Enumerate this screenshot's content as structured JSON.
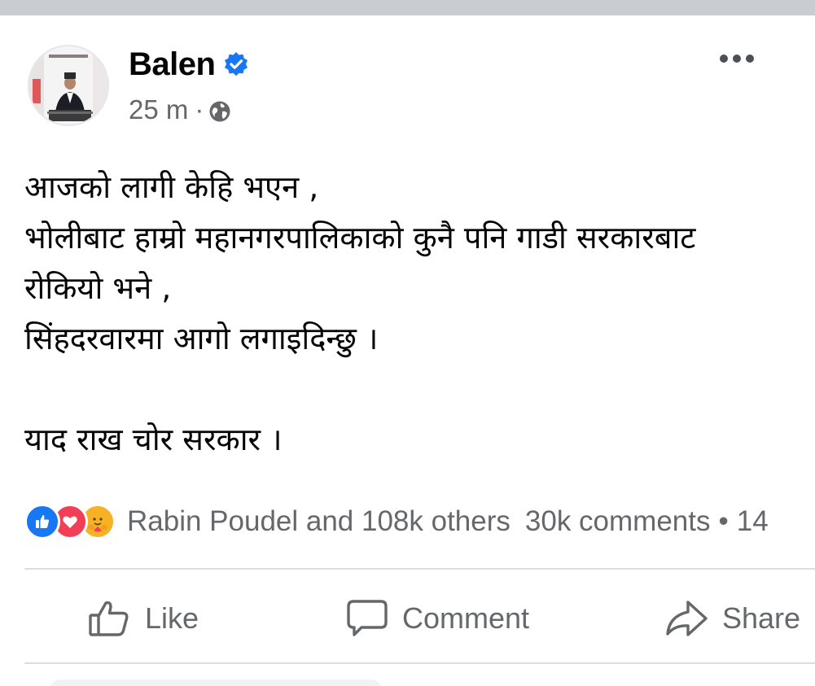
{
  "post": {
    "author": "Balen",
    "timestamp": "25 m",
    "separator": "·",
    "visibility_icon": "globe-icon",
    "verified_icon": "verified-badge-icon",
    "more_icon": "more-options-icon",
    "body_lines": [
      "आजको लागी केहि भएन ,",
      "भोलीबाट हाम्रो महानगरपालिकाको कुनै पनि गाडी सरकारबाट",
      "रोकियो भने ,",
      "सिंहदरवारमा आगो लगाइदिन्छु ।",
      "",
      "याद राख चोर सरकार ।"
    ]
  },
  "reactions": {
    "icons": [
      "like-reaction-icon",
      "love-reaction-icon",
      "care-reaction-icon"
    ],
    "summary": "Rabin Poudel and 108k others",
    "comments": "30k comments",
    "dot": "•",
    "shares_partial": "14"
  },
  "actions": {
    "like": "Like",
    "comment": "Comment",
    "share": "Share"
  },
  "colors": {
    "text_primary": "#050505",
    "text_secondary": "#65676b",
    "verified": "#1877f2",
    "like": "#1877f2",
    "love": "#f33e58",
    "care": "#f7b125",
    "divider": "#dadde1",
    "top_strip": "#c9ccd1"
  }
}
